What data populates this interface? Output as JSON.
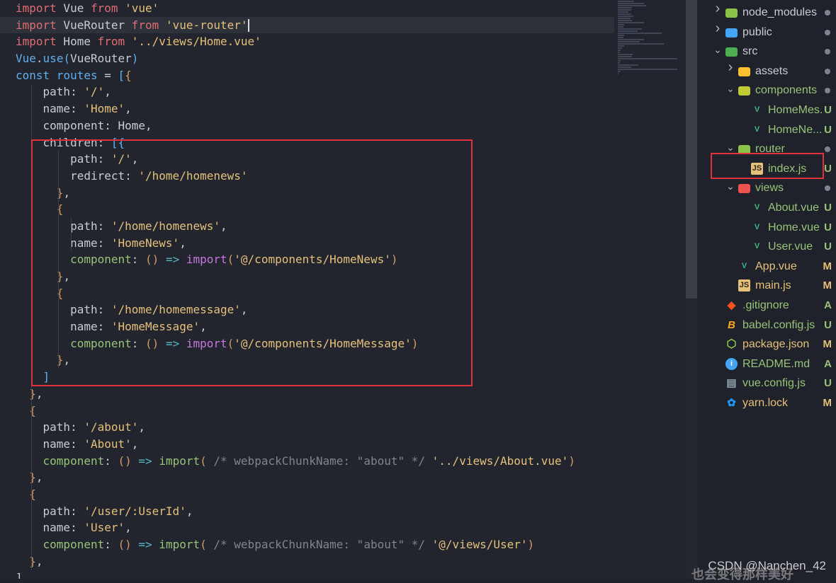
{
  "editor": {
    "lines": [
      [
        [
          "kw",
          "import"
        ],
        [
          "id",
          " Vue "
        ],
        [
          "kw",
          "from"
        ],
        [
          "pun",
          " "
        ],
        [
          "str",
          "'vue'"
        ]
      ],
      [
        [
          "kw",
          "import"
        ],
        [
          "id",
          " VueRouter "
        ],
        [
          "kw",
          "from"
        ],
        [
          "pun",
          " "
        ],
        [
          "str",
          "'vue-router'"
        ]
      ],
      [
        [
          "kw",
          "import"
        ],
        [
          "id",
          " Home "
        ],
        [
          "kw",
          "from"
        ],
        [
          "pun",
          " "
        ],
        [
          "str",
          "'../views/Home.vue'"
        ]
      ],
      [
        [
          "cls",
          "Vue"
        ],
        [
          "pun",
          "."
        ],
        [
          "cls",
          "use"
        ],
        [
          "brk",
          "("
        ],
        [
          "id",
          "VueRouter"
        ],
        [
          "brk",
          ")"
        ]
      ],
      [
        [
          "cls",
          "const"
        ],
        [
          "pun",
          " "
        ],
        [
          "cls",
          "routes"
        ],
        [
          "pun",
          " = "
        ],
        [
          "brk",
          "["
        ],
        [
          "br2",
          "{"
        ]
      ],
      [
        [
          "pun",
          "    "
        ],
        [
          "prop",
          "path"
        ],
        [
          "pun",
          ": "
        ],
        [
          "str",
          "'/'"
        ],
        [
          "pun",
          ","
        ]
      ],
      [
        [
          "pun",
          "    "
        ],
        [
          "prop",
          "name"
        ],
        [
          "pun",
          ": "
        ],
        [
          "str",
          "'Home'"
        ],
        [
          "pun",
          ","
        ]
      ],
      [
        [
          "pun",
          "    "
        ],
        [
          "prop",
          "component"
        ],
        [
          "pun",
          ": "
        ],
        [
          "id",
          "Home"
        ],
        [
          "pun",
          ","
        ]
      ],
      [
        [
          "pun",
          "    "
        ],
        [
          "prop",
          "children"
        ],
        [
          "pun",
          ": "
        ],
        [
          "brk",
          "[{"
        ]
      ],
      [
        [
          "pun",
          "        "
        ],
        [
          "prop",
          "path"
        ],
        [
          "pun",
          ": "
        ],
        [
          "str",
          "'/'"
        ],
        [
          "pun",
          ","
        ]
      ],
      [
        [
          "pun",
          "        "
        ],
        [
          "prop",
          "redirect"
        ],
        [
          "pun",
          ": "
        ],
        [
          "str",
          "'/home/homenews'"
        ]
      ],
      [
        [
          "pun",
          "      "
        ],
        [
          "br2",
          "}"
        ],
        [
          "pun",
          ","
        ]
      ],
      [
        [
          "pun",
          "      "
        ],
        [
          "br2",
          "{"
        ]
      ],
      [
        [
          "pun",
          "        "
        ],
        [
          "prop",
          "path"
        ],
        [
          "pun",
          ": "
        ],
        [
          "str",
          "'/home/homenews'"
        ],
        [
          "pun",
          ","
        ]
      ],
      [
        [
          "pun",
          "        "
        ],
        [
          "prop",
          "name"
        ],
        [
          "pun",
          ": "
        ],
        [
          "str",
          "'HomeNews'"
        ],
        [
          "pun",
          ","
        ]
      ],
      [
        [
          "pun",
          "        "
        ],
        [
          "fn",
          "component"
        ],
        [
          "pun",
          ": "
        ],
        [
          "br2",
          "()"
        ],
        [
          "pun",
          " "
        ],
        [
          "arr",
          "=>"
        ],
        [
          "pun",
          " "
        ],
        [
          "ctl",
          "import"
        ],
        [
          "br2",
          "("
        ],
        [
          "str",
          "'@/components/HomeNews'"
        ],
        [
          "br2",
          ")"
        ]
      ],
      [
        [
          "pun",
          "      "
        ],
        [
          "br2",
          "}"
        ],
        [
          "pun",
          ","
        ]
      ],
      [
        [
          "pun",
          "      "
        ],
        [
          "br2",
          "{"
        ]
      ],
      [
        [
          "pun",
          "        "
        ],
        [
          "prop",
          "path"
        ],
        [
          "pun",
          ": "
        ],
        [
          "str",
          "'/home/homemessage'"
        ],
        [
          "pun",
          ","
        ]
      ],
      [
        [
          "pun",
          "        "
        ],
        [
          "prop",
          "name"
        ],
        [
          "pun",
          ": "
        ],
        [
          "str",
          "'HomeMessage'"
        ],
        [
          "pun",
          ","
        ]
      ],
      [
        [
          "pun",
          "        "
        ],
        [
          "fn",
          "component"
        ],
        [
          "pun",
          ": "
        ],
        [
          "br2",
          "()"
        ],
        [
          "pun",
          " "
        ],
        [
          "arr",
          "=>"
        ],
        [
          "pun",
          " "
        ],
        [
          "ctl",
          "import"
        ],
        [
          "br2",
          "("
        ],
        [
          "str",
          "'@/components/HomeMessage'"
        ],
        [
          "br2",
          ")"
        ]
      ],
      [
        [
          "pun",
          "      "
        ],
        [
          "br2",
          "}"
        ],
        [
          "pun",
          ","
        ]
      ],
      [
        [
          "pun",
          "    "
        ],
        [
          "brk",
          "]"
        ]
      ],
      [
        [
          "pun",
          "  "
        ],
        [
          "br2",
          "}"
        ],
        [
          "pun",
          ","
        ]
      ],
      [
        [
          "pun",
          "  "
        ],
        [
          "br2",
          "{"
        ]
      ],
      [
        [
          "pun",
          "    "
        ],
        [
          "prop",
          "path"
        ],
        [
          "pun",
          ": "
        ],
        [
          "str",
          "'/about'"
        ],
        [
          "pun",
          ","
        ]
      ],
      [
        [
          "pun",
          "    "
        ],
        [
          "prop",
          "name"
        ],
        [
          "pun",
          ": "
        ],
        [
          "str",
          "'About'"
        ],
        [
          "pun",
          ","
        ]
      ],
      [
        [
          "pun",
          "    "
        ],
        [
          "fn",
          "component"
        ],
        [
          "pun",
          ": "
        ],
        [
          "br2",
          "()"
        ],
        [
          "pun",
          " "
        ],
        [
          "arr",
          "=>"
        ],
        [
          "pun",
          " "
        ],
        [
          "fn",
          "import"
        ],
        [
          "br2",
          "("
        ],
        [
          "pun",
          " "
        ],
        [
          "cmt",
          "/* webpackChunkName: \"about\" */"
        ],
        [
          "pun",
          " "
        ],
        [
          "str",
          "'../views/About.vue'"
        ],
        [
          "br2",
          ")"
        ]
      ],
      [
        [
          "pun",
          "  "
        ],
        [
          "br2",
          "}"
        ],
        [
          "pun",
          ","
        ]
      ],
      [
        [
          "pun",
          "  "
        ],
        [
          "br2",
          "{"
        ]
      ],
      [
        [
          "pun",
          "    "
        ],
        [
          "prop",
          "path"
        ],
        [
          "pun",
          ": "
        ],
        [
          "str",
          "'/user/:UserId'"
        ],
        [
          "pun",
          ","
        ]
      ],
      [
        [
          "pun",
          "    "
        ],
        [
          "prop",
          "name"
        ],
        [
          "pun",
          ": "
        ],
        [
          "str",
          "'User'"
        ],
        [
          "pun",
          ","
        ]
      ],
      [
        [
          "pun",
          "    "
        ],
        [
          "fn",
          "component"
        ],
        [
          "pun",
          ": "
        ],
        [
          "br2",
          "()"
        ],
        [
          "pun",
          " "
        ],
        [
          "arr",
          "=>"
        ],
        [
          "pun",
          " "
        ],
        [
          "fn",
          "import"
        ],
        [
          "br2",
          "("
        ],
        [
          "pun",
          " "
        ],
        [
          "cmt",
          "/* webpackChunkName: \"about\" */"
        ],
        [
          "pun",
          " "
        ],
        [
          "str",
          "'@/views/User'"
        ],
        [
          "br2",
          ")"
        ]
      ],
      [
        [
          "pun",
          "  "
        ],
        [
          "br2",
          "}"
        ],
        [
          "pun",
          ","
        ]
      ],
      [
        [
          "pun",
          "]"
        ]
      ]
    ],
    "current_line": 1
  },
  "explorer": {
    "items": [
      {
        "name": "node_modules",
        "kind": "folder",
        "depth": 0,
        "chev": "›",
        "decor": "dot",
        "color": "#c9ccd3",
        "icon_color": "#8bc34a"
      },
      {
        "name": "public",
        "kind": "folder",
        "depth": 0,
        "chev": "›",
        "decor": "dot",
        "color": "#c9ccd3",
        "icon_color": "#42a5f5"
      },
      {
        "name": "src",
        "kind": "folder",
        "depth": 0,
        "chev": "⌄",
        "decor": "dot",
        "color": "#c9ccd3",
        "icon_color": "#4caf50"
      },
      {
        "name": "assets",
        "kind": "folder",
        "depth": 1,
        "chev": "›",
        "decor": "dot",
        "color": "#c9ccd3",
        "icon_color": "#fbc02d"
      },
      {
        "name": "components",
        "kind": "folder",
        "depth": 1,
        "chev": "⌄",
        "decor": "dot",
        "color": "#98c379",
        "icon_color": "#c0ca33"
      },
      {
        "name": "HomeMes...",
        "kind": "vue",
        "depth": 2,
        "chev": "",
        "decor": "U",
        "color": "#98c379",
        "icon_color": "#3fb984"
      },
      {
        "name": "HomeNe...",
        "kind": "vue",
        "depth": 2,
        "chev": "",
        "decor": "U",
        "color": "#98c379",
        "icon_color": "#3fb984"
      },
      {
        "name": "router",
        "kind": "folder",
        "depth": 1,
        "chev": "⌄",
        "decor": "dot",
        "color": "#98c379",
        "icon_color": "#8bc34a"
      },
      {
        "name": "index.js",
        "kind": "js",
        "depth": 2,
        "chev": "",
        "decor": "U",
        "color": "#98c379",
        "icon_color": "#e5c07b"
      },
      {
        "name": "views",
        "kind": "folder",
        "depth": 1,
        "chev": "⌄",
        "decor": "dot",
        "color": "#98c379",
        "icon_color": "#ef5350"
      },
      {
        "name": "About.vue",
        "kind": "vue",
        "depth": 2,
        "chev": "",
        "decor": "U",
        "color": "#98c379",
        "icon_color": "#3fb984"
      },
      {
        "name": "Home.vue",
        "kind": "vue",
        "depth": 2,
        "chev": "",
        "decor": "U",
        "color": "#98c379",
        "icon_color": "#3fb984"
      },
      {
        "name": "User.vue",
        "kind": "vue",
        "depth": 2,
        "chev": "",
        "decor": "U",
        "color": "#98c379",
        "icon_color": "#3fb984"
      },
      {
        "name": "App.vue",
        "kind": "vue",
        "depth": 1,
        "chev": "",
        "decor": "M",
        "color": "#e5c07b",
        "icon_color": "#3fb984"
      },
      {
        "name": "main.js",
        "kind": "js",
        "depth": 1,
        "chev": "",
        "decor": "M",
        "color": "#e5c07b",
        "icon_color": "#e5c07b"
      },
      {
        "name": ".gitignore",
        "kind": "git",
        "depth": 0,
        "chev": "",
        "decor": "A",
        "color": "#98c379",
        "icon_color": "#f4511e"
      },
      {
        "name": "babel.config.js",
        "kind": "babel",
        "depth": 0,
        "chev": "",
        "decor": "U",
        "color": "#98c379",
        "icon_color": "#f9a825"
      },
      {
        "name": "package.json",
        "kind": "node",
        "depth": 0,
        "chev": "",
        "decor": "M",
        "color": "#e5c07b",
        "icon_color": "#8bc34a"
      },
      {
        "name": "README.md",
        "kind": "info",
        "depth": 0,
        "chev": "",
        "decor": "A",
        "color": "#98c379",
        "icon_color": "#42a5f5"
      },
      {
        "name": "vue.config.js",
        "kind": "file",
        "depth": 0,
        "chev": "",
        "decor": "U",
        "color": "#98c379",
        "icon_color": "#90a4ae"
      },
      {
        "name": "yarn.lock",
        "kind": "yarn",
        "depth": 0,
        "chev": "",
        "decor": "M",
        "color": "#e5c07b",
        "icon_color": "#2196f3"
      }
    ],
    "selected_index": 8
  },
  "watermark": {
    "text": "CSDN @Nanchen_42",
    "overlay": "也会变得那样美好"
  },
  "colors": {
    "decor_U": "#98c379",
    "decor_M": "#e5c07b",
    "decor_A": "#98c379",
    "highlight": "#e0303a"
  }
}
